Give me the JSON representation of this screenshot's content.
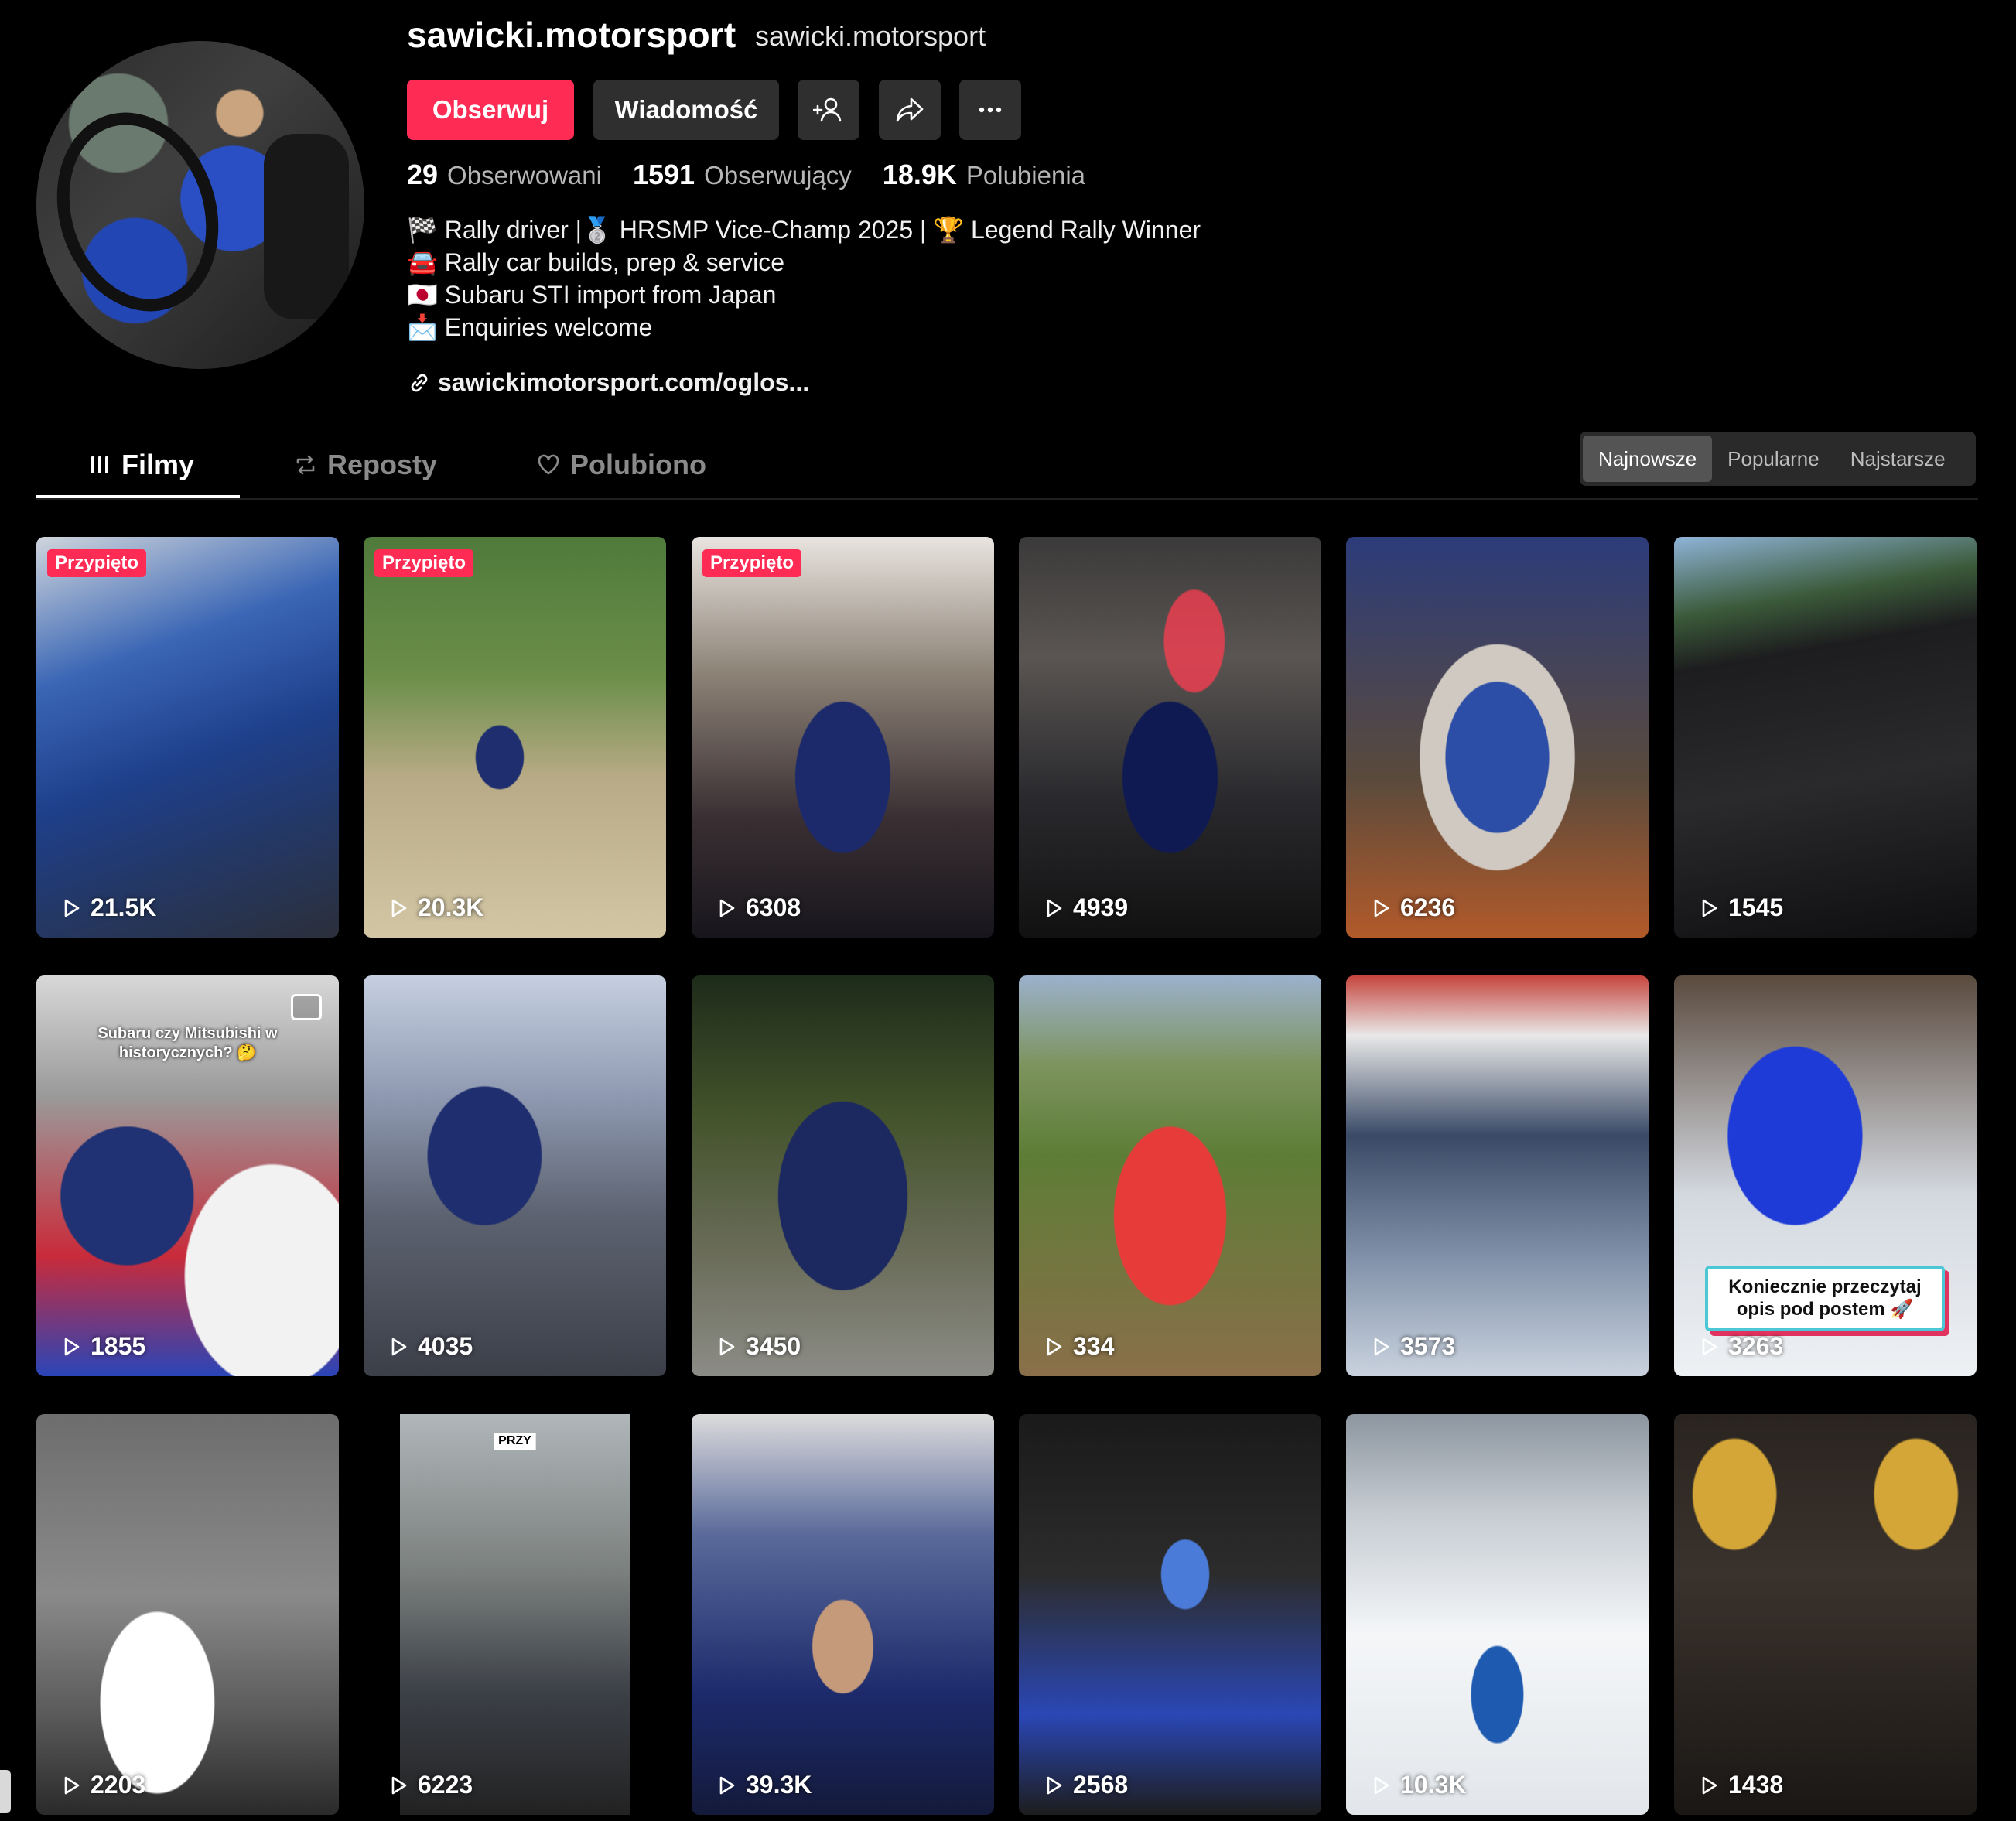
{
  "profile": {
    "username": "sawicki.motorsport",
    "nickname": "sawicki.motorsport",
    "avatar_icon": "profile-avatar",
    "buttons": {
      "follow": "Obserwuj",
      "message": "Wiadomość",
      "add_friend_icon": "add-user-icon",
      "share_icon": "share-icon",
      "more_icon": "more-icon"
    },
    "stats": [
      {
        "value": "29",
        "label": "Obserwowani"
      },
      {
        "value": "1591",
        "label": "Obserwujący"
      },
      {
        "value": "18.9K",
        "label": "Polubienia"
      }
    ],
    "bio": [
      "🏁 Rally driver |🥈 HRSMP Vice-Champ 2025 | 🏆 Legend Rally Winner",
      "🚘 Rally car builds, prep & service",
      "🇯🇵 Subaru STI import from Japan",
      "📩 Enquiries welcome"
    ],
    "link": "sawickimotorsport.com/oglos..."
  },
  "tabs": {
    "videos": "Filmy",
    "reposts": "Reposty",
    "liked": "Polubiono"
  },
  "sort": {
    "options": [
      "Najnowsze",
      "Popularne",
      "Najstarsze"
    ],
    "active": "Najnowsze"
  },
  "videos": [
    {
      "views": "21.5K",
      "pinned": "Przypięto"
    },
    {
      "views": "20.3K",
      "pinned": "Przypięto"
    },
    {
      "views": "6308",
      "pinned": "Przypięto"
    },
    {
      "views": "4939"
    },
    {
      "views": "6236"
    },
    {
      "views": "1545"
    },
    {
      "views": "1855",
      "overlay": "Subaru czy Mitsubishi w historycznych? 🤔"
    },
    {
      "views": "4035"
    },
    {
      "views": "3450"
    },
    {
      "views": "334"
    },
    {
      "views": "3573"
    },
    {
      "views": "3263",
      "caption": "Koniecznie przeczytaj opis pod postem 🚀"
    },
    {
      "views": "2203"
    },
    {
      "views": "6223",
      "sticker": "PRZY"
    },
    {
      "views": "39.3K"
    },
    {
      "views": "2568"
    },
    {
      "views": "10.3K"
    },
    {
      "views": "1438"
    }
  ]
}
